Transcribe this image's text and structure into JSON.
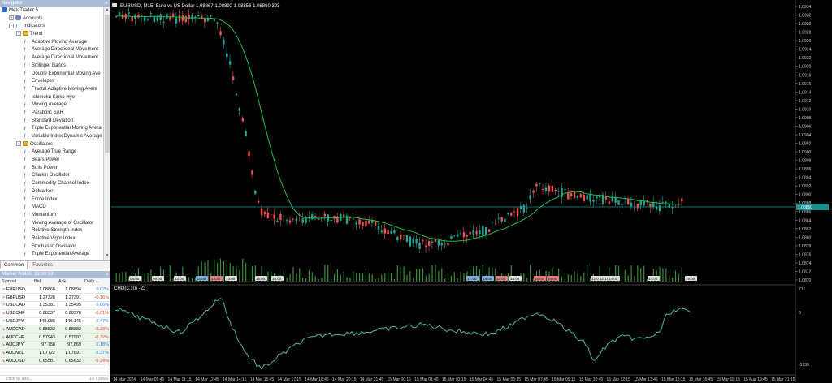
{
  "navigator": {
    "title": "Navigator",
    "items": [
      {
        "label": "MetaTrader 5",
        "level": 0,
        "icon": "metatrader-icon"
      },
      {
        "label": "Accounts",
        "level": 1,
        "icon": "accounts-icon",
        "expander": "+"
      },
      {
        "label": "Indicators",
        "level": 1,
        "icon": "indicator-icon",
        "expander": "-"
      },
      {
        "label": "Trend",
        "level": 2,
        "icon": "folder-icon",
        "expander": "-"
      },
      {
        "label": "Adaptive Moving Average",
        "level": 3,
        "icon": "indicator-icon"
      },
      {
        "label": "Average Directional Movement",
        "level": 3,
        "icon": "indicator-icon"
      },
      {
        "label": "Average Directional Movement",
        "level": 3,
        "icon": "indicator-icon"
      },
      {
        "label": "Bollinger Bands",
        "level": 3,
        "icon": "indicator-icon"
      },
      {
        "label": "Double Exponential Moving Ave",
        "level": 3,
        "icon": "indicator-icon"
      },
      {
        "label": "Envelopes",
        "level": 3,
        "icon": "indicator-icon"
      },
      {
        "label": "Fractal Adaptive Moving Avera",
        "level": 3,
        "icon": "indicator-icon"
      },
      {
        "label": "Ichimoku Kinko Hyo",
        "level": 3,
        "icon": "indicator-icon"
      },
      {
        "label": "Moving Average",
        "level": 3,
        "icon": "indicator-icon"
      },
      {
        "label": "Parabolic SAR",
        "level": 3,
        "icon": "indicator-icon"
      },
      {
        "label": "Standard Deviation",
        "level": 3,
        "icon": "indicator-icon"
      },
      {
        "label": "Triple Exponential Moving Avera",
        "level": 3,
        "icon": "indicator-icon"
      },
      {
        "label": "Variable Index Dynamic Average",
        "level": 3,
        "icon": "indicator-icon"
      },
      {
        "label": "Oscillators",
        "level": 2,
        "icon": "folder-icon",
        "expander": "-"
      },
      {
        "label": "Average True Range",
        "level": 3,
        "icon": "indicator-icon"
      },
      {
        "label": "Bears Power",
        "level": 3,
        "icon": "indicator-icon"
      },
      {
        "label": "Bulls Power",
        "level": 3,
        "icon": "indicator-icon"
      },
      {
        "label": "Chaikin Oscillator",
        "level": 3,
        "icon": "indicator-icon"
      },
      {
        "label": "Commodity Channel Index",
        "level": 3,
        "icon": "indicator-icon"
      },
      {
        "label": "DeMarker",
        "level": 3,
        "icon": "indicator-icon"
      },
      {
        "label": "Force Index",
        "level": 3,
        "icon": "indicator-icon"
      },
      {
        "label": "MACD",
        "level": 3,
        "icon": "indicator-icon"
      },
      {
        "label": "Momentum",
        "level": 3,
        "icon": "indicator-icon"
      },
      {
        "label": "Moving Average of Oscillator",
        "level": 3,
        "icon": "indicator-icon"
      },
      {
        "label": "Relative Strength Index",
        "level": 3,
        "icon": "indicator-icon"
      },
      {
        "label": "Relative Vigor Index",
        "level": 3,
        "icon": "indicator-icon"
      },
      {
        "label": "Stochastic Oscillator",
        "level": 3,
        "icon": "indicator-icon"
      },
      {
        "label": "Triple Exponential Average",
        "level": 3,
        "icon": "indicator-icon"
      }
    ],
    "tabs": [
      "Common",
      "Favorites"
    ],
    "active_tab": 0
  },
  "market_watch": {
    "title": "Market Watch: 22:20:59",
    "columns": [
      "Symbol",
      "Bid",
      "Ask",
      "Daily ..."
    ],
    "rows": [
      {
        "symbol": "EURUSD",
        "bid": "1.08866",
        "ask": "1.08894",
        "daily": "0.02%",
        "dir": "up"
      },
      {
        "symbol": "GBPUSD",
        "bid": "1.27326",
        "ask": "1.27391",
        "daily": "-0.16%",
        "dir": "up"
      },
      {
        "symbol": "USDCAD",
        "bid": "1.35381",
        "ask": "1.35495",
        "daily": "0.06%",
        "dir": "up"
      },
      {
        "symbol": "USDCHF",
        "bid": "0.88337",
        "ask": "0.88376",
        "daily": "-0.01%",
        "dir": "down"
      },
      {
        "symbol": "USDJPY",
        "bid": "148.986",
        "ask": "149.145",
        "daily": "0.47%",
        "dir": "up"
      },
      {
        "symbol": "AUDCAD",
        "bid": "0.88832",
        "ask": "0.88882",
        "daily": "-0.23%",
        "dir": "down"
      },
      {
        "symbol": "AUDCHF",
        "bid": "0.57943",
        "ask": "0.57992",
        "daily": "-0.32%",
        "dir": "down"
      },
      {
        "symbol": "AUDJPY",
        "bid": "97.758",
        "ask": "97.869",
        "daily": "0.18%",
        "dir": "down"
      },
      {
        "symbol": "AUDNZD",
        "bid": "1.07722",
        "ask": "1.07891",
        "daily": "0.37%",
        "dir": "down"
      },
      {
        "symbol": "AUDUSD",
        "bid": "0.65581",
        "ask": "0.65632",
        "daily": "-0.34%",
        "dir": "down"
      }
    ],
    "add_placeholder": "click to add...",
    "count": "10 / 3895"
  },
  "chart": {
    "header": "EURUSD, M15:  Euro vs US Dollar  1.08867  1.08892  1.08856  1.08860  393",
    "price_ticks": [
      "1.0934",
      "1.0932",
      "1.0930",
      "1.0928",
      "1.0926",
      "1.0924",
      "1.0922",
      "1.0920",
      "1.0918",
      "1.0916",
      "1.0914",
      "1.0912",
      "1.0910",
      "1.0908",
      "1.0906",
      "1.0904",
      "1.0902",
      "1.0900",
      "1.0898",
      "1.0896",
      "1.0894",
      "1.0892",
      "1.0890",
      "1.0888",
      "1.0886",
      "1.0884",
      "1.0882",
      "1.0880",
      "1.0878",
      "1.0876",
      "1.0874",
      "1.0872",
      "1.0870"
    ],
    "price_tag": "1.08860",
    "session_labels": [
      "08:00",
      "09:00",
      "12:00",
      "13:00",
      "13:30",
      "14:00",
      "15:00",
      "16:00",
      "17:00",
      "18:00",
      "13:00",
      "14:00",
      "15:00",
      "16:00",
      "12:00",
      "12:15",
      "14:00",
      "17:00",
      "19:00"
    ],
    "indicator_label": "CHO(3,10) -23",
    "indicator_ticks": [
      "771",
      "0",
      "-1739"
    ],
    "time_labels": [
      "14 Mar 2024",
      "14 Mar 09:45",
      "14 Mar 11:15",
      "14 Mar 12:45",
      "14 Mar 14:15",
      "14 Mar 15:45",
      "14 Mar 17:15",
      "14 Mar 18:45",
      "14 Mar 20:15",
      "14 Mar 21:45",
      "15 Mar 00:15",
      "15 Mar 01:45",
      "15 Mar 03:15",
      "15 Mar 04:45",
      "15 Mar 06:15",
      "15 Mar 07:45",
      "15 Mar 09:15",
      "15 Mar 10:45",
      "15 Mar 12:15",
      "15 Mar 13:45",
      "15 Mar 15:15",
      "15 Mar 16:45",
      "15 Mar 18:15",
      "15 Mar 19:45",
      "15 Mar 21:15"
    ],
    "colors": {
      "bull": "#26a69a",
      "bear": "#ef5350",
      "ma": "#1fbf4a",
      "osc": "#4fb3ad",
      "bid_line": "#1a8f8f"
    }
  }
}
